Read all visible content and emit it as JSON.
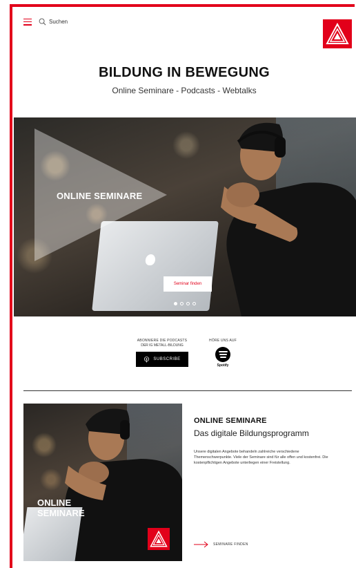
{
  "header": {
    "search_label": "Suchen"
  },
  "hero": {
    "title": "BILDUNG IN BEWEGUNG",
    "subtitle": "Online Seminare - Podcasts - Webtalks"
  },
  "slider": {
    "slide_title": "ONLINE SEMINARE",
    "cta_label": "Seminar finden",
    "dots": [
      true,
      false,
      false,
      false
    ]
  },
  "podcasts": {
    "line1": "ABONNIERE DIE PODCASTS",
    "line2": "DER IG METALL-BILDUNG",
    "subscribe_label": "SUBSCRIBE",
    "spotify_line": "HÖRE UNS AUF",
    "spotify_name": "Spotify"
  },
  "card": {
    "image_title_line1": "ONLINE",
    "image_title_line2": "SEMINARE",
    "title": "ONLINE SEMINARE",
    "subtitle": "Das digitale Bildungsprogramm",
    "body": "Unsere digitalen Angebote behandeln zahlreiche verschiedene Themenschwerpunkte. Viele der Seminare sind für alle offen und kostenfrei. Die kostenpflichtigen Angebote unterliegen einer Freistellung.",
    "link_label": "SEMINARE FINDEN"
  },
  "colors": {
    "brand_red": "#e2001a",
    "text": "#111111"
  }
}
